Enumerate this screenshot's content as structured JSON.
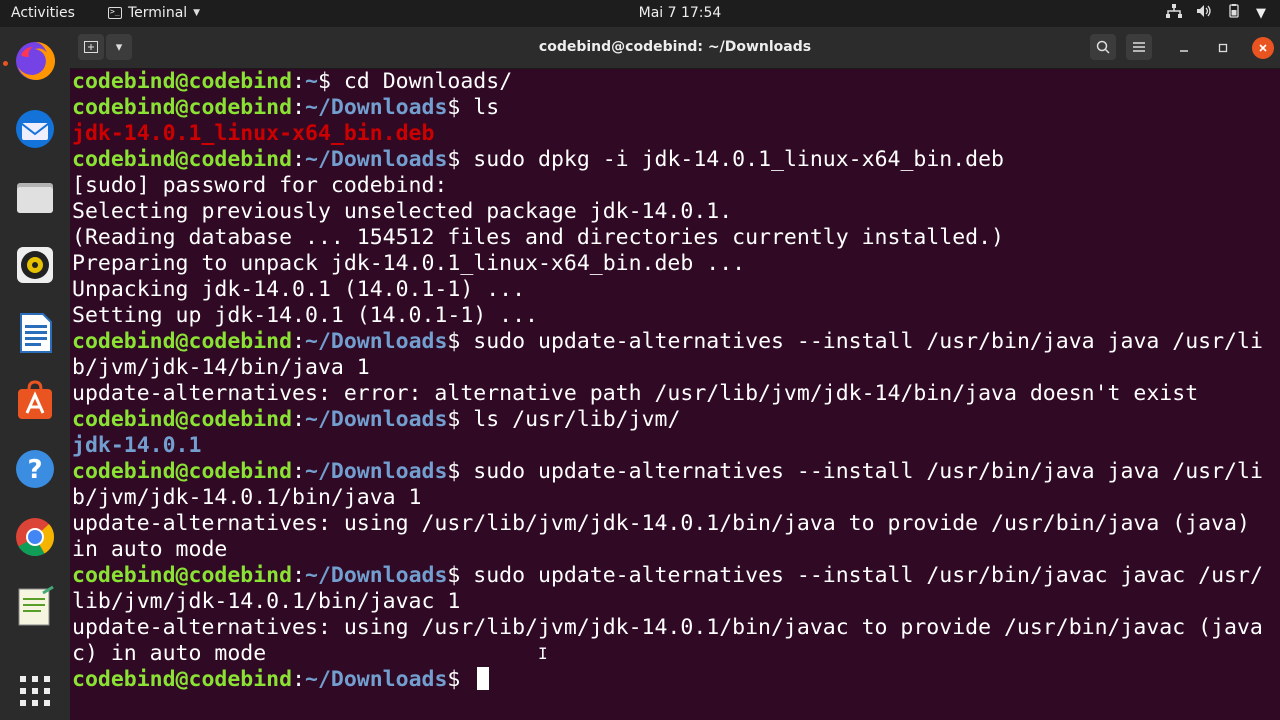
{
  "topbar": {
    "activities": "Activities",
    "app_menu": "Terminal",
    "clock": "Mai 7  17:54",
    "tray_icons": [
      "network-icon",
      "volume-icon",
      "battery-icon",
      "power-menu-icon"
    ]
  },
  "dock": {
    "apps": [
      "firefox-icon",
      "thunderbird-icon",
      "files-icon",
      "rhythmbox-icon",
      "libreoffice-writer-icon",
      "software-icon",
      "help-icon",
      "chrome-icon",
      "text-editor-icon",
      "show-apps-icon"
    ]
  },
  "window": {
    "title": "codebind@codebind: ~/Downloads",
    "colors": {
      "background": "#300a24",
      "user": "#8ae234",
      "path": "#729fcf",
      "error_file": "#cc0000",
      "close_button": "#e95420"
    }
  },
  "terminal": {
    "prompt_user": "codebind@codebind",
    "lines": [
      {
        "type": "prompt",
        "path": "~",
        "cmd": "cd Downloads/"
      },
      {
        "type": "prompt",
        "path": "~/Downloads",
        "cmd": "ls"
      },
      {
        "type": "file",
        "text": "jdk-14.0.1_linux-x64_bin.deb"
      },
      {
        "type": "prompt",
        "path": "~/Downloads",
        "cmd": "sudo dpkg -i jdk-14.0.1_linux-x64_bin.deb"
      },
      {
        "type": "out",
        "text": "[sudo] password for codebind:"
      },
      {
        "type": "out",
        "text": "Selecting previously unselected package jdk-14.0.1."
      },
      {
        "type": "out",
        "text": "(Reading database ... 154512 files and directories currently installed.)"
      },
      {
        "type": "out",
        "text": "Preparing to unpack jdk-14.0.1_linux-x64_bin.deb ..."
      },
      {
        "type": "out",
        "text": "Unpacking jdk-14.0.1 (14.0.1-1) ..."
      },
      {
        "type": "out",
        "text": "Setting up jdk-14.0.1 (14.0.1-1) ..."
      },
      {
        "type": "prompt",
        "path": "~/Downloads",
        "cmd": "sudo update-alternatives --install /usr/bin/java java /usr/li"
      },
      {
        "type": "out",
        "text": "b/jvm/jdk-14/bin/java 1"
      },
      {
        "type": "out",
        "text": "update-alternatives: error: alternative path /usr/lib/jvm/jdk-14/bin/java doesn't exist"
      },
      {
        "type": "prompt",
        "path": "~/Downloads",
        "cmd": "ls /usr/lib/jvm/"
      },
      {
        "type": "dir",
        "text": "jdk-14.0.1"
      },
      {
        "type": "prompt",
        "path": "~/Downloads",
        "cmd": "sudo update-alternatives --install /usr/bin/java java /usr/li"
      },
      {
        "type": "out",
        "text": "b/jvm/jdk-14.0.1/bin/java 1"
      },
      {
        "type": "out",
        "text": "update-alternatives: using /usr/lib/jvm/jdk-14.0.1/bin/java to provide /usr/bin/java (java)"
      },
      {
        "type": "out",
        "text": "in auto mode"
      },
      {
        "type": "prompt",
        "path": "~/Downloads",
        "cmd": "sudo update-alternatives --install /usr/bin/javac javac /usr/"
      },
      {
        "type": "out",
        "text": "lib/jvm/jdk-14.0.1/bin/javac 1"
      },
      {
        "type": "out",
        "text": "update-alternatives: using /usr/lib/jvm/jdk-14.0.1/bin/javac to provide /usr/bin/javac (java"
      },
      {
        "type": "out",
        "text": "c) in auto mode"
      },
      {
        "type": "prompt",
        "path": "~/Downloads",
        "cmd": ""
      }
    ]
  }
}
